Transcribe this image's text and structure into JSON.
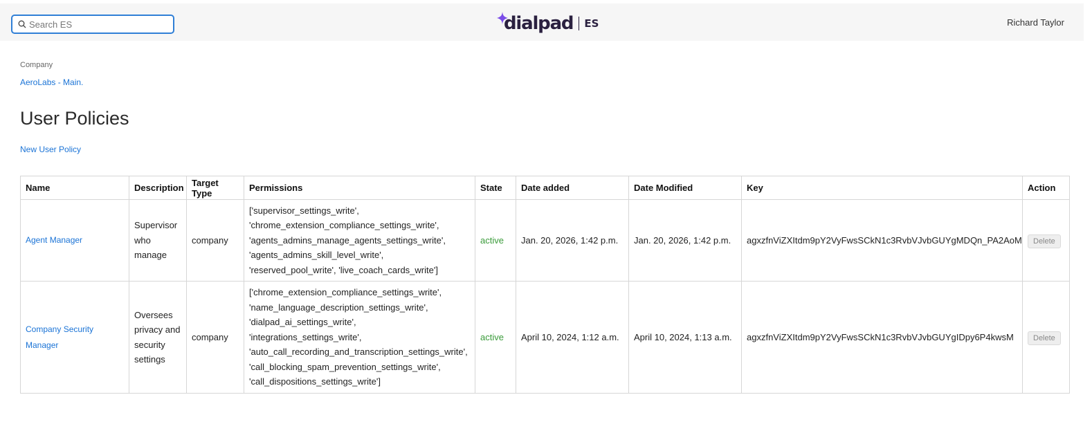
{
  "header": {
    "search_placeholder": "Search ES",
    "logo_text": "dialpad",
    "logo_suffix": "ES",
    "user_name": "Richard Taylor",
    "accent_color": "#7b4de8"
  },
  "breadcrumb": {
    "label": "Company",
    "link": "AeroLabs - Main."
  },
  "page": {
    "title": "User Policies",
    "new_link": "New User Policy"
  },
  "table": {
    "headers": [
      "Name",
      "Description",
      "Target Type",
      "Permissions",
      "State",
      "Date added",
      "Date Modified",
      "Key",
      "Action"
    ],
    "rows": [
      {
        "name": "Agent Manager",
        "description": "Supervisor who manage",
        "target_type": "company",
        "permissions": "['supervisor_settings_write', 'chrome_extension_compliance_settings_write', 'agents_admins_manage_agents_settings_write', 'agents_admins_skill_level_write', 'reserved_pool_write', 'live_coach_cards_write']",
        "state": "active",
        "date_added": "Jan. 20, 2026, 1:42 p.m.",
        "date_modified": "Jan. 20, 2026, 1:42 p.m.",
        "key": "agxzfnViZXItdm9pY2VyFwsSCkN1c3RvbVJvbGUYgMDQn_PA2AoM",
        "action": "Delete"
      },
      {
        "name": "Company Security Manager",
        "description": "Oversees privacy and security settings",
        "target_type": "company",
        "permissions": "['chrome_extension_compliance_settings_write', 'name_language_description_settings_write', 'dialpad_ai_settings_write', 'integrations_settings_write', 'auto_call_recording_and_transcription_settings_write', 'call_blocking_spam_prevention_settings_write', 'call_dispositions_settings_write']",
        "state": "active",
        "date_added": "April 10, 2024, 1:12 a.m.",
        "date_modified": "April 10, 2024, 1:13 a.m.",
        "key": "agxzfnViZXItdm9pY2VyFwsSCkN1c3RvbVJvbGUYgIDpy6P4kwsM",
        "action": "Delete"
      }
    ]
  }
}
